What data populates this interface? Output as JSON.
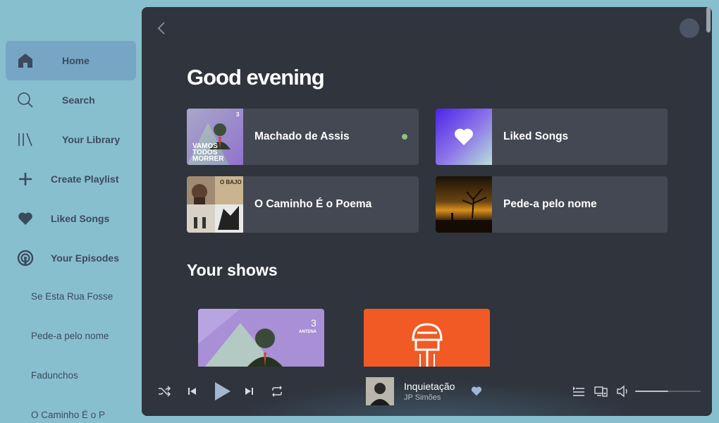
{
  "sidebar": {
    "nav": [
      {
        "label": "Home",
        "icon": "home-icon",
        "active": true
      },
      {
        "label": "Search",
        "icon": "search-icon"
      },
      {
        "label": "Your Library",
        "icon": "library-icon"
      },
      {
        "label": "Create Playlist",
        "icon": "plus-icon"
      },
      {
        "label": "Liked Songs",
        "icon": "heart-icon"
      },
      {
        "label": "Your Episodes",
        "icon": "podcast-icon"
      }
    ],
    "playlists": [
      "Se Esta Rua Fosse",
      "Pede-a pelo nome",
      "Fadunchos",
      "O Caminho É o P"
    ]
  },
  "main": {
    "greeting": "Good evening",
    "cards": [
      {
        "title": "Machado de Assis",
        "art_text_1": "VAMOS",
        "art_text_2": "TODOS",
        "art_text_3": "MORRER",
        "badge": "3"
      },
      {
        "title": "Liked Songs"
      },
      {
        "title": "O Caminho É o Poema",
        "art_text": "O BAJO"
      },
      {
        "title": "Pede-a pelo nome"
      }
    ],
    "shows_heading": "Your shows",
    "shows": [
      {
        "badge": "3",
        "badge_sub": "ANTENA"
      },
      {}
    ]
  },
  "player": {
    "track_title": "Inquietação",
    "artist": "JP Simões",
    "volume": 0.5,
    "liked": true
  },
  "colors": {
    "sidebar_bg": "#88bfcf",
    "active_nav": "#77a6c4",
    "panel_bg": "#2f343d",
    "card_bg": "#434852",
    "now_playing_dot": "#8fbf83",
    "liked_gradient_start": "#4b23e8",
    "liked_gradient_end": "#b6e1d8",
    "show_orange": "#f15a24",
    "show_purple": "#a98fd6"
  }
}
